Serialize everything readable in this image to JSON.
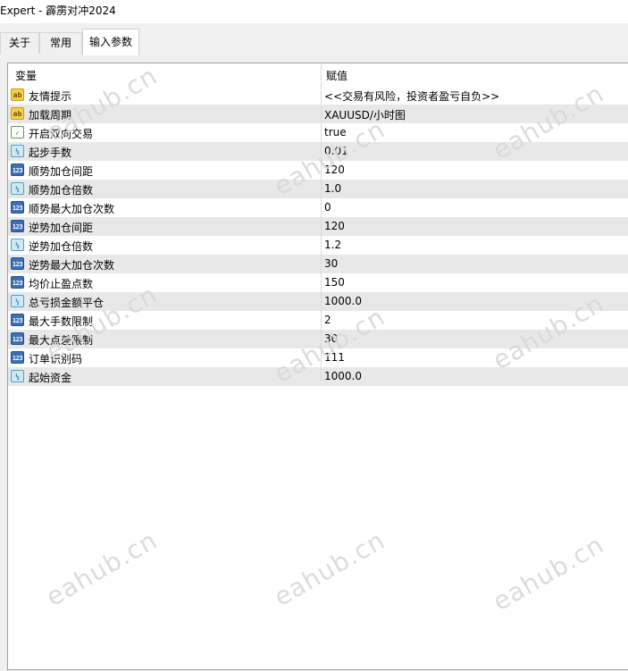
{
  "window": {
    "title": "Expert - 霹雳对冲2024"
  },
  "tabs": [
    {
      "label": "关于",
      "active": false
    },
    {
      "label": "常用",
      "active": false
    },
    {
      "label": "输入参数",
      "active": true
    }
  ],
  "grid": {
    "headers": {
      "variable": "变量",
      "value": "赋值"
    },
    "rows": [
      {
        "icon": "text-type-icon",
        "name": "友情提示",
        "value": "<<交易有风险，投资者盈亏自负>>"
      },
      {
        "icon": "text-type-icon",
        "name": "加载周期",
        "value": "XAUUSD/小时图"
      },
      {
        "icon": "boolean-type-icon",
        "name": "开启双向交易",
        "value": "true"
      },
      {
        "icon": "double-type-icon",
        "name": "起步手数",
        "value": "0.01"
      },
      {
        "icon": "integer-type-icon",
        "name": "顺势加仓间距",
        "value": "120"
      },
      {
        "icon": "double-type-icon",
        "name": "顺势加仓倍数",
        "value": "1.0"
      },
      {
        "icon": "integer-type-icon",
        "name": "顺势最大加仓次数",
        "value": "0"
      },
      {
        "icon": "integer-type-icon",
        "name": "逆势加仓间距",
        "value": "120"
      },
      {
        "icon": "double-type-icon",
        "name": "逆势加仓倍数",
        "value": "1.2"
      },
      {
        "icon": "integer-type-icon",
        "name": "逆势最大加仓次数",
        "value": "30"
      },
      {
        "icon": "integer-type-icon",
        "name": "均价止盈点数",
        "value": "150"
      },
      {
        "icon": "double-type-icon",
        "name": "总亏损金额平仓",
        "value": "1000.0"
      },
      {
        "icon": "integer-type-icon",
        "name": "最大手数限制",
        "value": "2"
      },
      {
        "icon": "integer-type-icon",
        "name": "最大点差限制",
        "value": "30"
      },
      {
        "icon": "integer-type-icon",
        "name": "订单识别码",
        "value": "111"
      },
      {
        "icon": "double-type-icon",
        "name": "起始资金",
        "value": "1000.0"
      }
    ]
  },
  "watermark": {
    "text": "eahub.cn"
  },
  "icon_glyphs": {
    "ab": "ab",
    "num": "123",
    "half": "½",
    "bool": "✓"
  }
}
